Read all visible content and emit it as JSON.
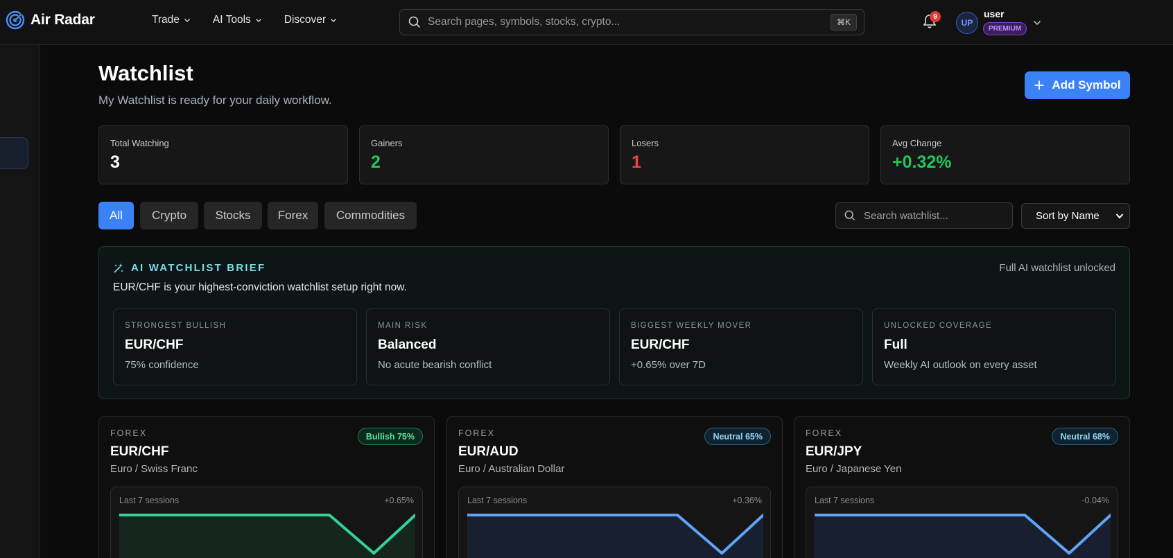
{
  "app": {
    "name": "Air Radar"
  },
  "nav": {
    "items": [
      {
        "label": "Trade"
      },
      {
        "label": "AI Tools"
      },
      {
        "label": "Discover"
      }
    ]
  },
  "search": {
    "placeholder": "Search pages, symbols, stocks, crypto...",
    "shortcut": "⌘K"
  },
  "notifications": {
    "count": "9"
  },
  "user": {
    "initials": "UP",
    "name": "user",
    "plan": "PREMIUM"
  },
  "header": {
    "title": "Watchlist",
    "subtitle": "My Watchlist is ready for your daily workflow.",
    "add_label": "Add Symbol"
  },
  "stats": [
    {
      "label": "Total Watching",
      "value": "3",
      "color": "#ffffff"
    },
    {
      "label": "Gainers",
      "value": "2",
      "color": "#22c55e"
    },
    {
      "label": "Losers",
      "value": "1",
      "color": "#ef4444"
    },
    {
      "label": "Avg Change",
      "value": "+0.32%",
      "color": "#22c55e"
    }
  ],
  "filters": {
    "tabs": [
      {
        "label": "All",
        "active": true
      },
      {
        "label": "Crypto"
      },
      {
        "label": "Stocks"
      },
      {
        "label": "Forex"
      },
      {
        "label": "Commodities"
      }
    ],
    "search_placeholder": "Search watchlist...",
    "sort_label": "Sort by Name"
  },
  "brief": {
    "title": "AI WATCHLIST BRIEF",
    "status": "Full AI watchlist unlocked",
    "summary": "EUR/CHF is your highest-conviction watchlist setup right now.",
    "cards": [
      {
        "label": "STRONGEST BULLISH",
        "value": "EUR/CHF",
        "sub": "75% confidence"
      },
      {
        "label": "MAIN RISK",
        "value": "Balanced",
        "sub": "No acute bearish conflict"
      },
      {
        "label": "BIGGEST WEEKLY MOVER",
        "value": "EUR/CHF",
        "sub": "+0.65% over 7D"
      },
      {
        "label": "UNLOCKED COVERAGE",
        "value": "Full",
        "sub": "Weekly AI outlook on every asset"
      }
    ]
  },
  "assets": [
    {
      "category": "FOREX",
      "symbol": "EUR/CHF",
      "name": "Euro / Swiss Franc",
      "badge": "Bullish 75%",
      "sentiment": "bullish",
      "spark_label": "Last 7 sessions",
      "change": "+0.65%",
      "line_color": "#34d399",
      "fill_color": "#14261e",
      "series": [
        1,
        1,
        1,
        1,
        1,
        0.05,
        1
      ]
    },
    {
      "category": "FOREX",
      "symbol": "EUR/AUD",
      "name": "Euro / Australian Dollar",
      "badge": "Neutral 65%",
      "sentiment": "neutral",
      "spark_label": "Last 7 sessions",
      "change": "+0.36%",
      "line_color": "#60a5fa",
      "fill_color": "#182030",
      "series": [
        1,
        1,
        1,
        1,
        1,
        0.05,
        1
      ]
    },
    {
      "category": "FOREX",
      "symbol": "EUR/JPY",
      "name": "Euro / Japanese Yen",
      "badge": "Neutral 68%",
      "sentiment": "neutral",
      "spark_label": "Last 7 sessions",
      "change": "-0.04%",
      "line_color": "#60a5fa",
      "fill_color": "#182030",
      "series": [
        1,
        1,
        1,
        1,
        1,
        0.05,
        1
      ]
    }
  ]
}
